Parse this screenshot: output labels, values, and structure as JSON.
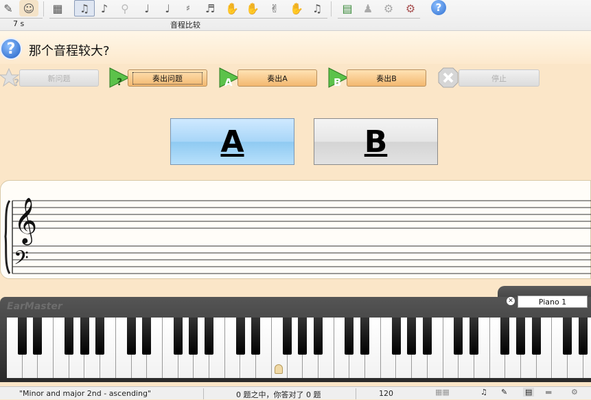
{
  "toolbar": {
    "timer": "7 s",
    "group_label": "音程比较"
  },
  "question": {
    "text": "那个音程较大?"
  },
  "buttons": {
    "new_question": "新问题",
    "play_question": "奏出问题",
    "play_a": "奏出A",
    "play_b": "奏出B",
    "stop": "停止"
  },
  "answers": {
    "a": "A",
    "b": "B"
  },
  "keyboard": {
    "title": "EarMaster",
    "instrument": "Piano 1"
  },
  "status": {
    "exercise": "\"Minor and major 2nd - ascending\"",
    "score": "0 题之中，你答对了 0 题",
    "tempo": "120"
  },
  "colors": {
    "accent_orange": "#f3b870",
    "answer_a_blue": "#a8d6f8",
    "play_green": "#3aa83a"
  }
}
